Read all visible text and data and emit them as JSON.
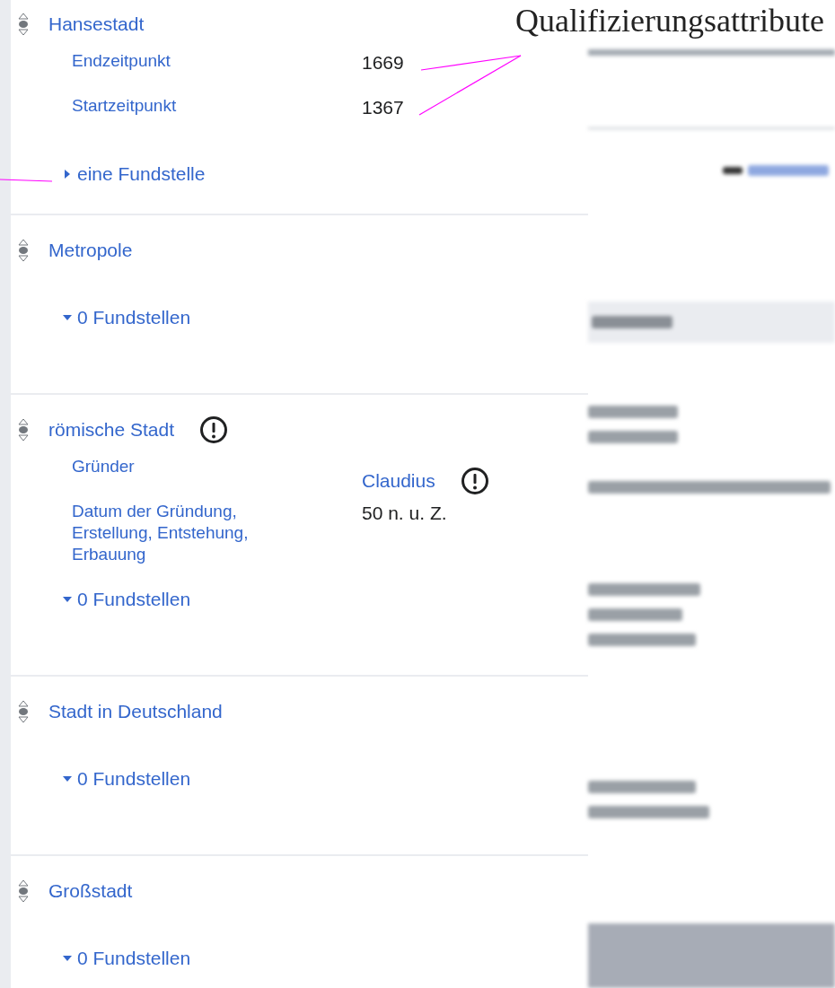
{
  "annotation": {
    "label": "Qualifizierungsattribute"
  },
  "statements": [
    {
      "value": "Hansestadt",
      "warning": false,
      "qualifiers": [
        {
          "property": "Endzeitpunkt",
          "value": "1669",
          "kind": "text",
          "warning": false
        },
        {
          "property": "Startzeitpunkt",
          "value": "1367",
          "kind": "text",
          "warning": false
        }
      ],
      "references": {
        "label": "eine Fundstelle",
        "expanded": false
      }
    },
    {
      "value": "Metropole",
      "warning": false,
      "references": {
        "label": "0 Fundstellen",
        "expanded": true
      }
    },
    {
      "value": "römische Stadt",
      "warning": true,
      "qualifiers": [
        {
          "property": "Gründer",
          "value": "Claudius",
          "kind": "item",
          "warning": true
        },
        {
          "property": "Datum der Gründung, Erstellung, Entstehung, Erbauung",
          "value": "50 n. u. Z.",
          "kind": "text",
          "warning": false
        }
      ],
      "references": {
        "label": "0 Fundstellen",
        "expanded": true
      }
    },
    {
      "value": "Stadt in Deutschland",
      "warning": false,
      "references": {
        "label": "0 Fundstellen",
        "expanded": true
      }
    },
    {
      "value": "Großstadt",
      "warning": false,
      "references": {
        "label": "0 Fundstellen",
        "expanded": true
      }
    }
  ]
}
